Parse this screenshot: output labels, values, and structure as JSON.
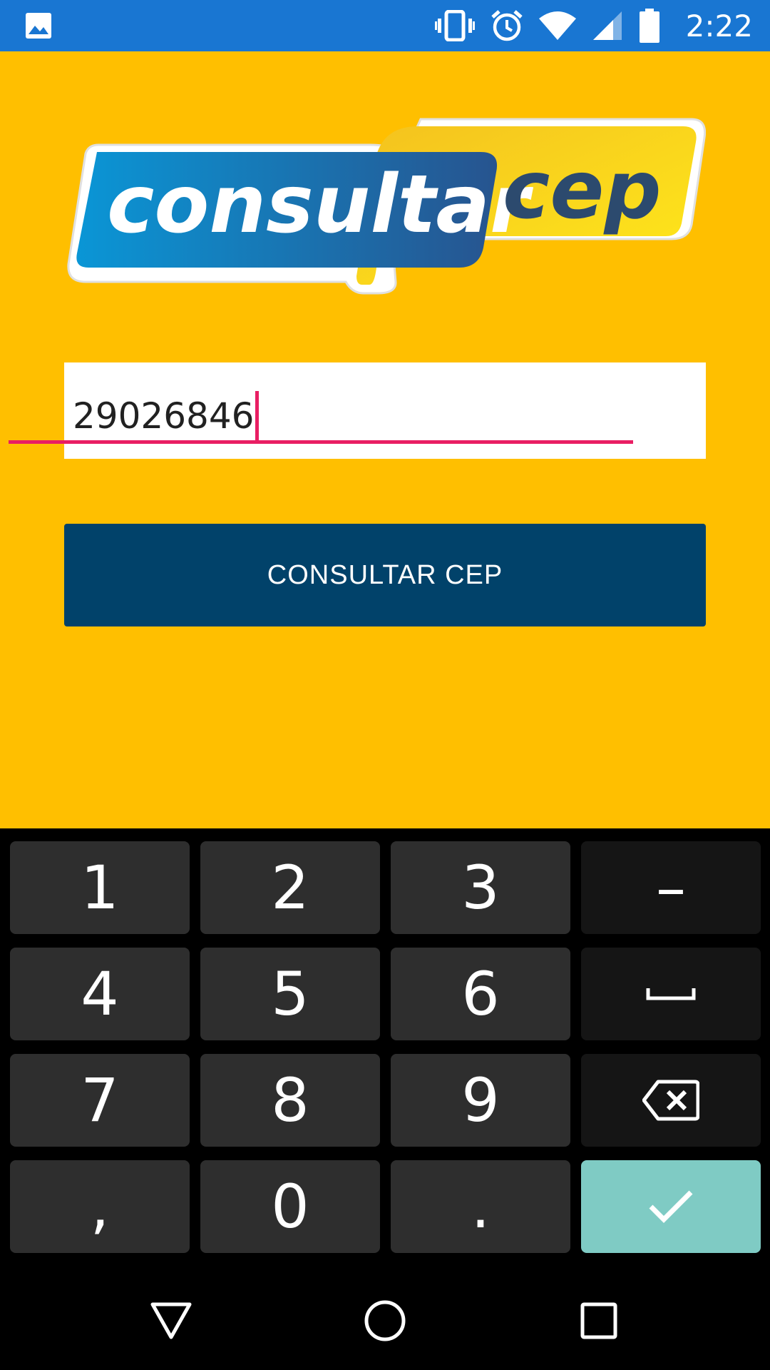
{
  "status_bar": {
    "time": "2:22",
    "icons": [
      "gallery-notification-icon",
      "vibrate-icon",
      "alarm-icon",
      "wifi-icon",
      "cell-signal-icon",
      "battery-icon"
    ],
    "color": "#1976D2"
  },
  "logo": {
    "left_text": "consultar",
    "right_text": "cep"
  },
  "cep_input": {
    "value": "29026846",
    "accent_color": "#E91E63"
  },
  "consult_button": {
    "label": "CONSULTAR CEP",
    "color": "#01426A"
  },
  "keyboard": {
    "keys": {
      "k1": "1",
      "k2": "2",
      "k3": "3",
      "dash": "–",
      "k4": "4",
      "k5": "5",
      "k6": "6",
      "k7": "7",
      "k8": "8",
      "k9": "9",
      "comma": ",",
      "k0": "0",
      "period": "."
    },
    "icons": [
      "space-icon",
      "backspace-icon",
      "checkmark-icon"
    ],
    "done_color": "#7FCBC4"
  },
  "nav_bar": {
    "icons": [
      "back-icon",
      "home-icon",
      "recents-icon"
    ]
  },
  "theme": {
    "background": "#FFBF00"
  }
}
